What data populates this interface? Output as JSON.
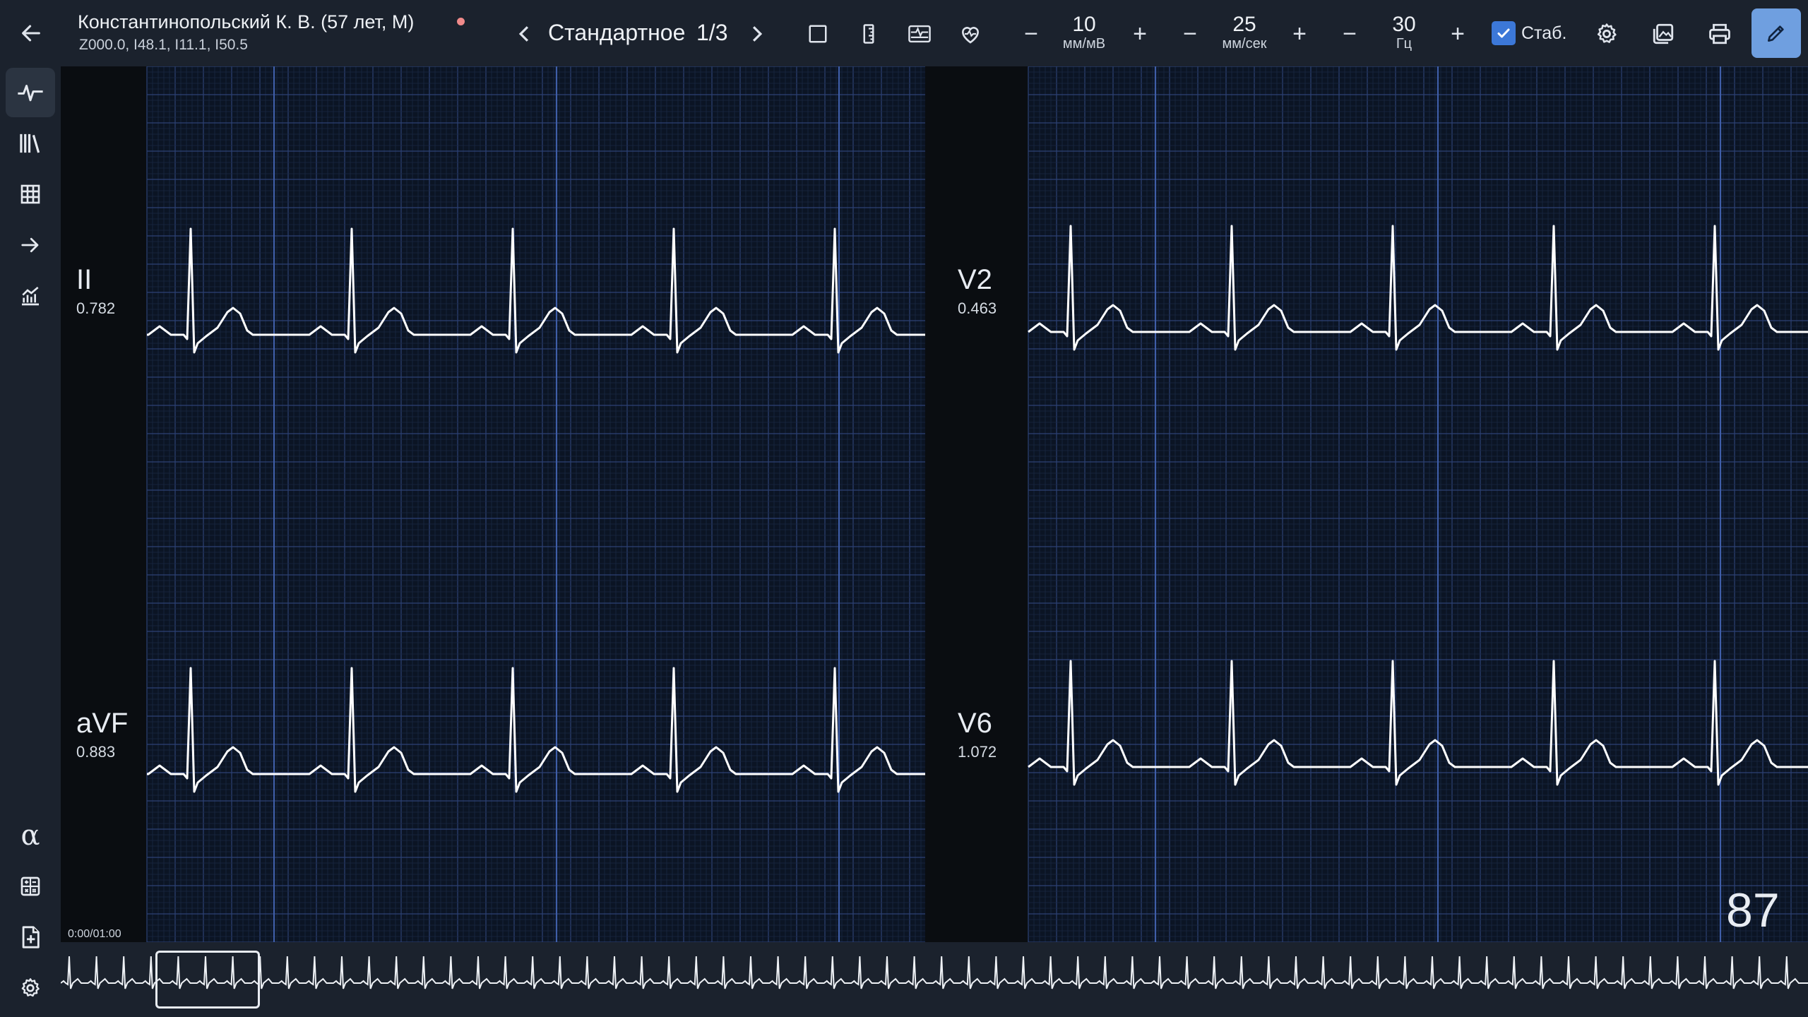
{
  "patient": {
    "name": "Константинопольский К. В. (57 лет, М)",
    "codes": "Z000.0, I48.1, I11.1, I50.5",
    "status_color": "#f08a8a"
  },
  "view": {
    "prev_label": "‹",
    "title": "Стандартное",
    "page": "1/3",
    "next_label": "›"
  },
  "toolbar": {
    "icons": [
      "square-icon",
      "ruler-icon",
      "compare-icon",
      "heart-rate-icon"
    ],
    "amplitude": {
      "value": "10",
      "unit": "мм/мВ",
      "minus": "−",
      "plus": "+"
    },
    "speed": {
      "value": "25",
      "unit": "мм/сек",
      "minus": "−",
      "plus": "+"
    },
    "filter": {
      "value": "30",
      "unit": "Гц",
      "minus": "−",
      "plus": "+"
    },
    "stabilize": {
      "label": "Стаб.",
      "checked": true
    },
    "right_icons": [
      "gear-icon",
      "gallery-icon",
      "printer-icon",
      "pencil-icon"
    ]
  },
  "sidebar": {
    "top": [
      "ecg-wave-icon",
      "library-icon",
      "grid-icon",
      "arrow-right-icon",
      "chart-icon"
    ],
    "bottom": [
      "alpha-icon",
      "calculator-icon",
      "file-add-icon",
      "settings-icon"
    ],
    "alpha_glyph": "α"
  },
  "leads": [
    {
      "name": "II",
      "amp": "0.782"
    },
    {
      "name": "aVF",
      "amp": "0.883"
    },
    {
      "name": "V2",
      "amp": "0.463"
    },
    {
      "name": "V6",
      "amp": "1.072"
    }
  ],
  "heart_rate": "87",
  "time_position": "0:00/01:00",
  "colors": {
    "accent": "#5a8fd6",
    "grid_minor": "#1a2742",
    "grid_major": "#2d4275",
    "grid_bold": "#3f5ea8",
    "trace": "#ffffff",
    "checkbox": "#3c78d8"
  }
}
